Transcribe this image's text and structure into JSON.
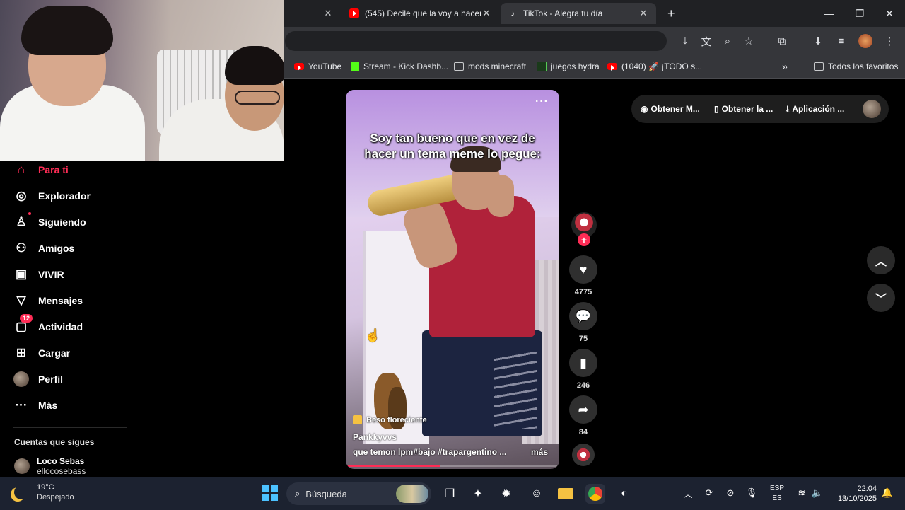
{
  "browser": {
    "tabs": [
      {
        "label": "(545) Decile que la voy a hacer",
        "icon": "youtube-icon",
        "active": false
      },
      {
        "label": "TikTok - Alegra tu día",
        "icon": "tiktok-icon",
        "active": true
      }
    ],
    "new_tab": "+",
    "window_controls": {
      "minimize": "—",
      "restore": "❐",
      "close": "✕"
    },
    "bookmarks": [
      {
        "label": "YouTube",
        "icon": "youtube-icon"
      },
      {
        "label": "Stream - Kick Dashb...",
        "icon": "kick-icon"
      },
      {
        "label": "mods minecraft",
        "icon": "folder-icon"
      },
      {
        "label": "juegos hydra",
        "icon": "hydra-icon"
      },
      {
        "label": "(1040) 🚀 ¡TODO s...",
        "icon": "youtube-icon"
      }
    ],
    "bookmarks_overflow": "»",
    "all_favorites": "Todos los favoritos"
  },
  "sidebar": {
    "items": [
      {
        "label": "Para ti",
        "icon": "home-icon",
        "active": true
      },
      {
        "label": "Explorador",
        "icon": "compass-icon"
      },
      {
        "label": "Siguiendo",
        "icon": "following-icon"
      },
      {
        "label": "Amigos",
        "icon": "friends-icon"
      },
      {
        "label": "VIVIR",
        "icon": "live-icon"
      },
      {
        "label": "Mensajes",
        "icon": "messages-icon"
      },
      {
        "label": "Actividad",
        "icon": "activity-icon",
        "badge": "12"
      },
      {
        "label": "Cargar",
        "icon": "upload-icon"
      },
      {
        "label": "Perfil",
        "icon": "profile-avatar"
      },
      {
        "label": "Más",
        "icon": "more-icon"
      }
    ],
    "following_title": "Cuentas que sigues",
    "following": [
      {
        "name": "Loco Sebas",
        "username": "ellocosebass"
      }
    ]
  },
  "video": {
    "caption": "Soy tan bueno que en vez de hacer un tema meme lo pegue:",
    "effect": "Beso floreciente",
    "author": "Pankkyvvs",
    "description": "que temon lpm#bajo  #trapargentino  ...",
    "more": "más",
    "menu": "···",
    "progress_percent": 44
  },
  "actions": {
    "follow": "+",
    "likes": "4775",
    "comments": "75",
    "saves": "246",
    "shares": "84"
  },
  "top_chips": [
    {
      "label": "Obtener M...",
      "icon": "coin-icon"
    },
    {
      "label": "Obtener la ...",
      "icon": "phone-icon"
    },
    {
      "label": "Aplicación ...",
      "icon": "download-icon"
    }
  ],
  "taskbar": {
    "weather_temp": "19°C",
    "weather_desc": "Despejado",
    "search_placeholder": "Búsqueda",
    "lang_top": "ESP",
    "lang_bottom": "ES",
    "time": "22:04",
    "date": "13/10/2025"
  },
  "colors": {
    "accent": "#fe2c55",
    "background": "#000000",
    "chrome_dark": "#202124",
    "chrome_toolbar": "#35363a",
    "taskbar": "#1c2230"
  }
}
